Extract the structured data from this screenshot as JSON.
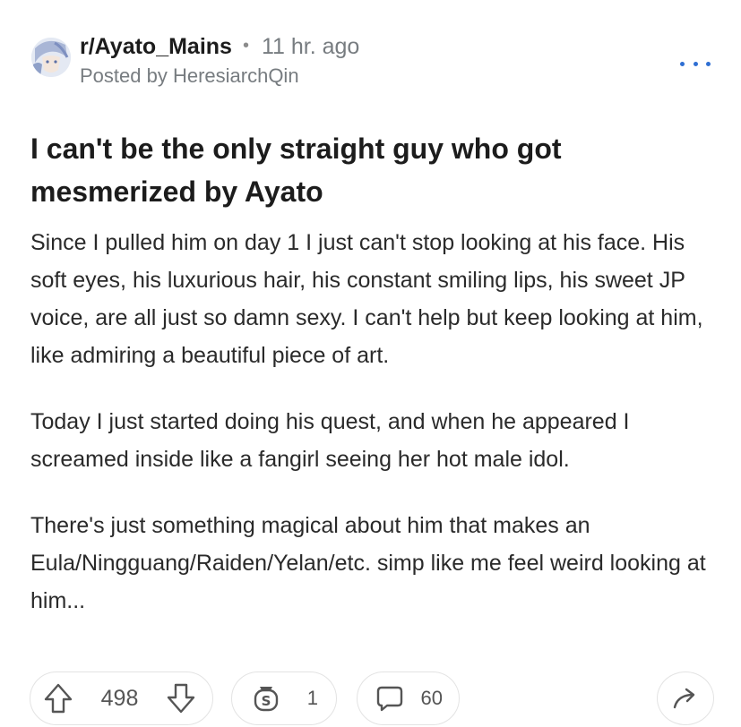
{
  "post": {
    "subreddit": "r/Ayato_Mains",
    "separator": "•",
    "time": "11 hr. ago",
    "posted_by": "Posted by HeresiarchQin",
    "title": "I can't be the only straight guy who got mesmerized by Ayato",
    "paragraphs": [
      "Since I pulled him on day 1 I just can't stop looking at his face. His soft eyes, his luxurious hair, his constant smiling lips, his sweet JP voice, are all just so damn sexy. I can't help but keep looking at him, like admiring a beautiful piece of art.",
      "Today I just started doing his quest, and when he appeared I screamed inside like a fangirl seeing her hot male idol.",
      "There's just something magical about him that makes an Eula/Ningguang/Raiden/Yelan/etc. simp like me feel weird looking at him..."
    ]
  },
  "actions": {
    "votes": "498",
    "awards": "1",
    "comments": "60"
  },
  "icons": {
    "more": "more-options-icon",
    "upvote": "upvote-arrow-icon",
    "downvote": "downvote-arrow-icon",
    "award": "award-coin-icon",
    "comment": "comment-bubble-icon",
    "share": "share-arrow-icon"
  },
  "colors": {
    "accent": "#2f6fd3",
    "text": "#1c1c1c",
    "muted": "#777c80"
  }
}
